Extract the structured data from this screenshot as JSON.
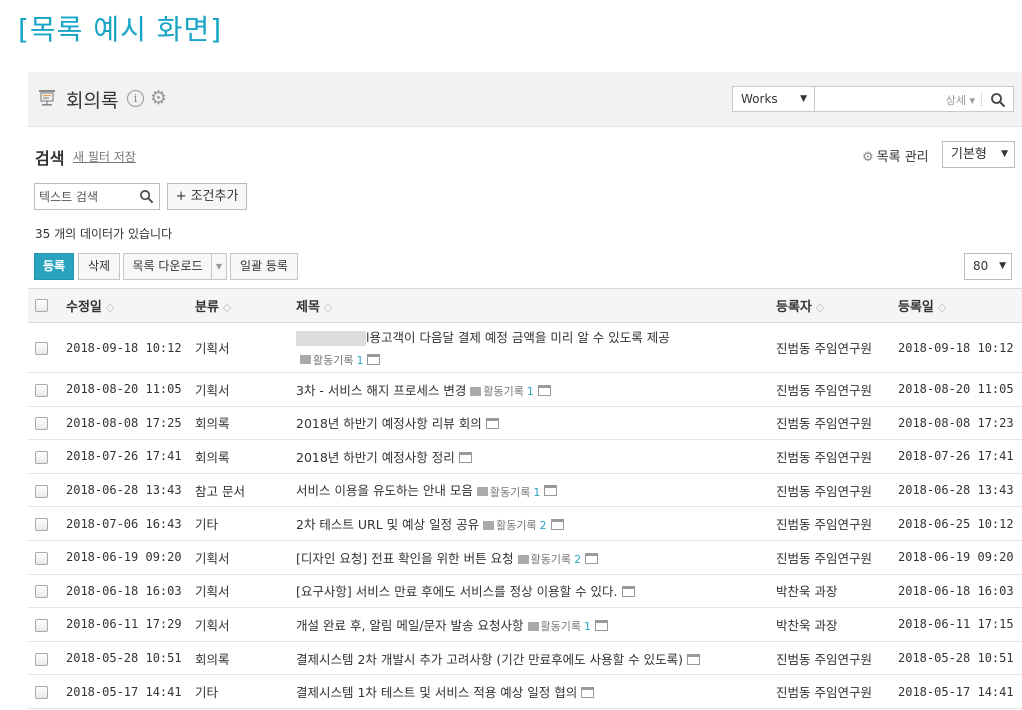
{
  "caption": "[목록 예시 화면]",
  "header": {
    "title": "회의록",
    "info_glyph": "i",
    "works_select": "Works",
    "search_detail": "상세"
  },
  "filter": {
    "search_label": "검색",
    "new_filter": "새 필터 저장",
    "list_manage": "목록 관리",
    "view_select": "기본형",
    "text_search_placeholder": "텍스트 검색",
    "add_condition": "+ 조건추가",
    "count_text": "35 개의 데이터가 있습니다"
  },
  "toolbar": {
    "register": "등록",
    "delete": "삭제",
    "download": "목록 다운로드",
    "bulk_register": "일괄 등록",
    "page_size": "80"
  },
  "activity_label": "활동기록",
  "columns": {
    "modified": "수정일",
    "category": "분류",
    "title": "제목",
    "author": "등록자",
    "registered": "등록일"
  },
  "rows": [
    {
      "modified": "2018-09-18 10:12",
      "category": "기획서",
      "title": "l용고객이 다음달 결제 예정 금액을 미리 알 수 있도록 제공",
      "activity": "1",
      "author": "진범동 주임연구원",
      "registered": "2018-09-18 10:12"
    },
    {
      "modified": "2018-08-20 11:05",
      "category": "기획서",
      "title": "3차 - 서비스 해지 프로세스 변경",
      "activity": "1",
      "author": "진범동 주임연구원",
      "registered": "2018-08-20 11:05"
    },
    {
      "modified": "2018-08-08 17:25",
      "category": "회의록",
      "title": "2018년 하반기 예정사항 리뷰 회의",
      "activity": "",
      "author": "진범동 주임연구원",
      "registered": "2018-08-08 17:23"
    },
    {
      "modified": "2018-07-26 17:41",
      "category": "회의록",
      "title": "2018년 하반기 예정사항 정리",
      "activity": "",
      "author": "진범동 주임연구원",
      "registered": "2018-07-26 17:41"
    },
    {
      "modified": "2018-06-28 13:43",
      "category": "참고 문서",
      "title": "서비스 이용을 유도하는 안내 모음",
      "activity": "1",
      "author": "진범동 주임연구원",
      "registered": "2018-06-28 13:43"
    },
    {
      "modified": "2018-07-06 16:43",
      "category": "기타",
      "title": "2차 테스트 URL 및 예상 일정 공유",
      "activity": "2",
      "author": "진범동 주임연구원",
      "registered": "2018-06-25 10:12"
    },
    {
      "modified": "2018-06-19 09:20",
      "category": "기획서",
      "title": "[디자인 요청] 전표 확인을 위한 버튼 요청",
      "activity": "2",
      "author": "진범동 주임연구원",
      "registered": "2018-06-19 09:20"
    },
    {
      "modified": "2018-06-18 16:03",
      "category": "기획서",
      "title": "[요구사항] 서비스 만료 후에도 서비스를 정상 이용할 수 있다.",
      "activity": "",
      "author": "박찬욱 과장",
      "registered": "2018-06-18 16:03"
    },
    {
      "modified": "2018-06-11 17:29",
      "category": "기획서",
      "title": "개설 완료 후, 알림 메일/문자 발송 요청사항",
      "activity": "1",
      "author": "박찬욱 과장",
      "registered": "2018-06-11 17:15"
    },
    {
      "modified": "2018-05-28 10:51",
      "category": "회의록",
      "title": "결제시스템 2차 개발시 추가 고려사항 (기간 만료후에도 사용할 수 있도록)",
      "activity": "",
      "author": "진범동 주임연구원",
      "registered": "2018-05-28 10:51"
    },
    {
      "modified": "2018-05-17 14:41",
      "category": "기타",
      "title": "결제시스템 1차 테스트 및 서비스 적용 예상 일정 협의",
      "activity": "",
      "author": "진범동 주임연구원",
      "registered": "2018-05-17 14:41"
    }
  ]
}
